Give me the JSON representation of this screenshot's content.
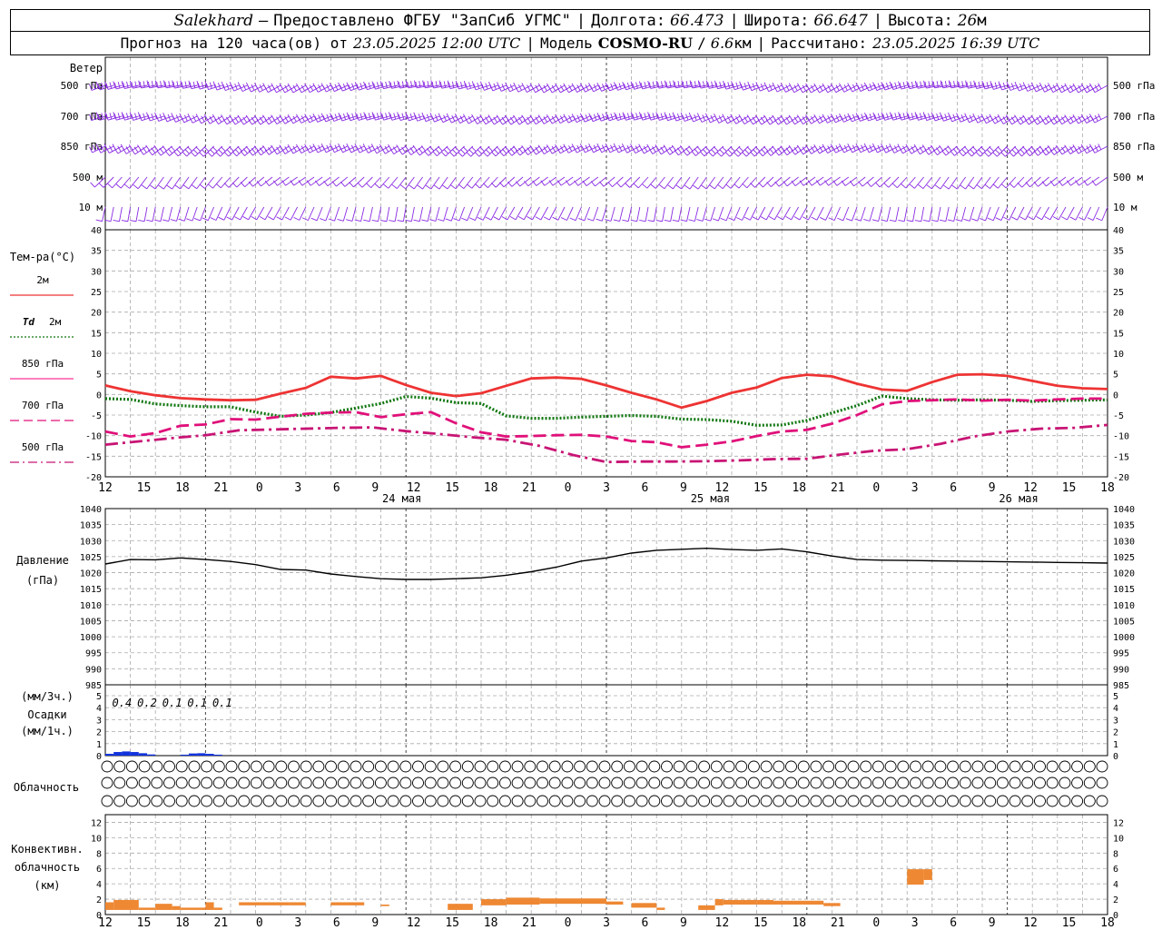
{
  "header": {
    "station": "Salekhard",
    "dash": "–",
    "provided_by": "Предоставлено ФГБУ \"ЗапСиб УГМС\"",
    "lon_label": "Долгота:",
    "lon_value": "66.473",
    "lat_label": "Широта:",
    "lat_value": "66.647",
    "alt_label": "Высота:",
    "alt_value": "26",
    "alt_unit": "м",
    "forecast_prefix": "Прогноз на 120 часа(ов) от",
    "forecast_start": "23.05.2025 12:00 UTC",
    "model_label": "Модель",
    "model_name": "COSMO-RU",
    "model_res": "6.6",
    "model_res_unit": "км",
    "calc_label": "Рассчитано:",
    "calc_time": "23.05.2025 16:39 UTC"
  },
  "colors": {
    "wind": "#8a2be2",
    "t2m": "#ee3333",
    "td2m": "#117711",
    "t850": "#ff3399",
    "t700": "#e0107a",
    "t500": "#c81474",
    "pressure": "#000000",
    "precip": "#1133dd",
    "convective": "#ee8833",
    "grid": "#aaaaaa"
  },
  "chart_data": [
    {
      "type": "wind-barbs",
      "title": "Ветер",
      "levels_left": [
        "500 гПа",
        "700 гПа",
        "850 гПа",
        "500 м",
        "10 м"
      ],
      "levels_right": [
        "500 гПа",
        "700 гПа",
        "850 гПа",
        "500 м",
        "10 м"
      ],
      "x_hours": [
        0,
        120
      ],
      "step_hours": 1
    },
    {
      "type": "line",
      "title": "Тем-ра(°C)",
      "legend": [
        {
          "label": "2м",
          "style": "solid",
          "color": "#ee3333"
        },
        {
          "label_bold": "Td",
          "label": "2м",
          "style": "dotted",
          "color": "#117711"
        },
        {
          "label": "850 гПа",
          "style": "solid",
          "color": "#ff3399"
        },
        {
          "label": "700 гПа",
          "style": "dashed",
          "color": "#e0107a"
        },
        {
          "label": "500 гПа",
          "style": "dashed",
          "color": "#c81474"
        }
      ],
      "ylim": [
        -20,
        40
      ],
      "y_ticks": [
        -20,
        -15,
        -10,
        -5,
        0,
        5,
        10,
        15,
        20,
        25,
        30,
        35,
        40
      ],
      "x_hours": [
        0,
        3,
        6,
        9,
        12,
        15,
        18,
        21,
        24,
        27,
        30,
        33,
        36,
        39,
        42,
        45,
        48,
        51,
        54,
        57,
        60,
        63,
        66,
        69,
        72,
        75,
        78,
        81,
        84,
        87,
        90,
        93,
        96,
        99,
        102,
        105,
        108,
        111,
        114,
        117,
        120
      ],
      "series": [
        {
          "name": "2м",
          "values": [
            2.2,
            0.8,
            -0.2,
            -0.9,
            -1.2,
            -1.4,
            -1.3,
            0.2,
            1.6,
            4.3,
            3.9,
            4.5,
            2.3,
            0.4,
            -0.4,
            0.3,
            2.1,
            3.9,
            4.1,
            3.8,
            2.2,
            0.4,
            -1.2,
            -3.2,
            -1.6,
            0.4,
            1.7,
            4.0,
            4.8,
            4.4,
            2.6,
            1.2,
            0.9,
            3.0,
            4.8,
            4.9,
            4.5,
            3.3,
            2.1,
            1.5,
            1.3
          ]
        },
        {
          "name": "Td 2м",
          "values": [
            -1.0,
            -1.2,
            -2.3,
            -2.7,
            -3.0,
            -3.0,
            -4.3,
            -5.3,
            -5.0,
            -4.4,
            -3.3,
            -2.2,
            -0.5,
            -0.9,
            -2.0,
            -2.2,
            -5.2,
            -5.8,
            -5.8,
            -5.5,
            -5.3,
            -5.1,
            -5.3,
            -6.0,
            -6.1,
            -6.5,
            -7.5,
            -7.4,
            -6.3,
            -4.5,
            -2.7,
            -0.4,
            -1.0,
            -1.3,
            -1.4,
            -1.3,
            -1.4,
            -1.7,
            -1.5,
            -1.4,
            -1.3
          ]
        },
        {
          "name": "850 гПа",
          "values": [
            -9.0,
            -10.2,
            -9.4,
            -7.6,
            -7.3,
            -6.0,
            -6.1,
            -5.4,
            -4.7,
            -4.4,
            -4.3,
            -5.5,
            -4.8,
            -4.3,
            -7.0,
            -9.2,
            -10.2,
            -10.1,
            -9.9,
            -9.8,
            -10.2,
            -11.3,
            -11.6,
            -12.8,
            -12.2,
            -11.4,
            -10.1,
            -9.0,
            -8.6,
            -7.1,
            -5.0,
            -2.4,
            -1.6,
            -1.4,
            -1.2,
            -1.5,
            -1.3,
            -1.5,
            -1.2,
            -1.0,
            -1.0
          ]
        },
        {
          "name": "700 гПа",
          "values": [
            -9.0,
            -10.2,
            -9.4,
            -7.6,
            -7.3,
            -6.0,
            -6.1,
            -5.4,
            -4.7,
            -4.4,
            -4.3,
            -5.5,
            -4.8,
            -4.3,
            -7.0,
            -9.2,
            -10.2,
            -10.1,
            -9.9,
            -9.8,
            -10.2,
            -11.3,
            -11.6,
            -12.8,
            -12.2,
            -11.4,
            -10.1,
            -9.0,
            -8.6,
            -7.1,
            -5.0,
            -2.4,
            -1.6,
            -1.4,
            -1.2,
            -1.5,
            -1.3,
            -1.5,
            -1.2,
            -1.0,
            -1.0
          ]
        },
        {
          "name": "500 гПа",
          "values": [
            -12.2,
            -11.4,
            -10.6,
            -9.9,
            -8.7,
            -8.5,
            -8.3,
            -8.1,
            -8.0,
            -8.9,
            -9.6,
            -10.4,
            -11.0,
            -12.5,
            -14.7,
            -16.4,
            -16.3,
            -16.3,
            -16.2,
            -16.0,
            -15.7,
            -15.6,
            -14.6,
            -13.7,
            -13.3,
            -12.0,
            -10.2,
            -9.0,
            -8.3,
            -8.1,
            -7.4
          ]
        }
      ],
      "x_tick_labels": [
        "12",
        "15",
        "18",
        "21",
        "0",
        "3",
        "6",
        "9",
        "12",
        "15",
        "18",
        "21",
        "0",
        "3",
        "6",
        "9",
        "12",
        "15",
        "18",
        "21",
        "0",
        "3",
        "6",
        "9",
        "12",
        "15",
        "18"
      ],
      "day_labels": [
        "24 мая",
        "25 мая",
        "26 мая"
      ]
    },
    {
      "type": "line",
      "title": "Давление",
      "unit": "(гПа)",
      "ylim": [
        985,
        1040
      ],
      "y_ticks": [
        985,
        990,
        995,
        1000,
        1005,
        1010,
        1015,
        1020,
        1025,
        1030,
        1035,
        1040
      ],
      "x_hours": [
        0,
        3,
        6,
        9,
        12,
        15,
        18,
        21,
        24,
        27,
        30,
        33,
        36,
        39,
        42,
        45,
        48,
        51,
        54,
        57,
        60,
        63,
        66,
        69,
        72,
        75,
        78,
        81,
        84,
        87,
        90,
        93,
        96,
        99,
        102,
        105,
        108,
        111,
        114,
        117,
        120
      ],
      "series": [
        {
          "name": "Давление",
          "values": [
            1022.7,
            1024.1,
            1024.0,
            1024.6,
            1024.1,
            1023.5,
            1022.5,
            1021.0,
            1020.8,
            1019.6,
            1018.8,
            1018.1,
            1017.9,
            1017.9,
            1018.1,
            1018.4,
            1019.2,
            1020.3,
            1021.7,
            1023.6,
            1024.6,
            1026.1,
            1027.0,
            1027.3,
            1027.6,
            1027.2,
            1027.0,
            1027.4,
            1026.5,
            1025.2,
            1024.1,
            1023.9,
            1023.8,
            1023.7,
            1023.6,
            1023.5,
            1023.4,
            1023.3,
            1023.2,
            1023.1,
            1023.0
          ]
        }
      ]
    },
    {
      "type": "bar",
      "title": "Осадки",
      "unit_top": "(мм/3ч.)",
      "unit_bottom": "(мм/1ч.)",
      "ylim": [
        0,
        5
      ],
      "y_ticks": [
        0,
        1,
        2,
        3,
        4,
        5
      ],
      "labels": [
        {
          "hour": 2,
          "text": "0.4"
        },
        {
          "hour": 5,
          "text": "0.2"
        },
        {
          "hour": 8,
          "text": "0.1"
        },
        {
          "hour": 11,
          "text": "0.1"
        },
        {
          "hour": 14,
          "text": "0.1"
        }
      ],
      "bars": [
        {
          "h0": 0,
          "h1": 1,
          "v": 0.15
        },
        {
          "h0": 1,
          "h1": 2,
          "v": 0.3
        },
        {
          "h0": 2,
          "h1": 3,
          "v": 0.35
        },
        {
          "h0": 3,
          "h1": 4,
          "v": 0.3
        },
        {
          "h0": 4,
          "h1": 5,
          "v": 0.2
        },
        {
          "h0": 5,
          "h1": 6,
          "v": 0.1
        },
        {
          "h0": 9,
          "h1": 10,
          "v": 0.08
        },
        {
          "h0": 10,
          "h1": 11,
          "v": 0.18
        },
        {
          "h0": 11,
          "h1": 12,
          "v": 0.2
        },
        {
          "h0": 12,
          "h1": 13,
          "v": 0.15
        },
        {
          "h0": 13,
          "h1": 14,
          "v": 0.08
        }
      ]
    },
    {
      "type": "table",
      "title": "Облачность",
      "rows_octas": [
        "000000000000000000000000000000000000000000000000000000000000000000000000000000000000000000000000000000000000000000000000000000000000000000000000000000000000000000000000000000000000000000000000000000000000000000000000000000000000000000000000000000000000000000000000000000000000000000000000000000000000000000000000000000000000000000000000000000000000000000000000000000000000000000000000000000000000000000",
        "00000000000000000000000000000000000000000000000000000000000000000000000000000000000000000000000000000000000000000000000000000000000000000000000000000000000000000000000000000000000000000000000000000000000000000000000000000000000000000000000000000000000000000000000000000000000000000000000000000000000000000000000000000000000000000000000000000000000000000000000000000000000000000000000000000000000000000",
        "000000000000000000000000000000000000000000000000000000000000000000000000000000000000000000000000000000000000000000000000000000000000000000000000000000000000000000000000000000000000000000000000000000000000000000000000000000000000000000000000000000000000000000000000000000000000000000000000000000000000000000000000000000000000000000000000000000000000000000000000000000000000000000000000000000000000000000000"
      ]
    },
    {
      "type": "bar",
      "title": "Конвективн.",
      "title2": "облачность",
      "unit": "(км)",
      "ylim": [
        0,
        13
      ],
      "y_ticks": [
        0,
        2,
        4,
        6,
        8,
        10,
        12
      ],
      "bars": [
        {
          "h0": 0,
          "h1": 1,
          "lo": 0.6,
          "hi": 1.6
        },
        {
          "h0": 1,
          "h1": 4,
          "lo": 0.6,
          "hi": 1.9
        },
        {
          "h0": 4,
          "h1": 6,
          "lo": 0.6,
          "hi": 0.9
        },
        {
          "h0": 6,
          "h1": 8,
          "lo": 0.6,
          "hi": 1.4
        },
        {
          "h0": 8,
          "h1": 9,
          "lo": 0.6,
          "hi": 1.1
        },
        {
          "h0": 9,
          "h1": 12,
          "lo": 0.6,
          "hi": 0.9
        },
        {
          "h0": 12,
          "h1": 13,
          "lo": 0.6,
          "hi": 1.6
        },
        {
          "h0": 13,
          "h1": 14,
          "lo": 0.6,
          "hi": 0.9
        },
        {
          "h0": 16,
          "h1": 22,
          "lo": 1.2,
          "hi": 1.6
        },
        {
          "h0": 22,
          "h1": 24,
          "lo": 1.2,
          "hi": 1.6
        },
        {
          "h0": 27,
          "h1": 31,
          "lo": 1.2,
          "hi": 1.6
        },
        {
          "h0": 33,
          "h1": 34,
          "lo": 1.1,
          "hi": 1.3
        },
        {
          "h0": 41,
          "h1": 44,
          "lo": 0.6,
          "hi": 1.4
        },
        {
          "h0": 45,
          "h1": 48,
          "lo": 1.2,
          "hi": 2.0
        },
        {
          "h0": 48,
          "h1": 52,
          "lo": 1.3,
          "hi": 2.2
        },
        {
          "h0": 52,
          "h1": 60,
          "lo": 1.4,
          "hi": 2.1
        },
        {
          "h0": 60,
          "h1": 62,
          "lo": 1.3,
          "hi": 1.7
        },
        {
          "h0": 63,
          "h1": 66,
          "lo": 0.9,
          "hi": 1.5
        },
        {
          "h0": 66,
          "h1": 67,
          "lo": 0.6,
          "hi": 0.9
        },
        {
          "h0": 71,
          "h1": 73,
          "lo": 0.6,
          "hi": 1.2
        },
        {
          "h0": 73,
          "h1": 74,
          "lo": 1.2,
          "hi": 2.0
        },
        {
          "h0": 74,
          "h1": 78,
          "lo": 1.3,
          "hi": 1.9
        },
        {
          "h0": 78,
          "h1": 80,
          "lo": 1.3,
          "hi": 1.9
        },
        {
          "h0": 80,
          "h1": 86,
          "lo": 1.3,
          "hi": 1.8
        },
        {
          "h0": 86,
          "h1": 88,
          "lo": 1.1,
          "hi": 1.5
        },
        {
          "h0": 96,
          "h1": 98,
          "lo": 3.9,
          "hi": 5.9
        },
        {
          "h0": 98,
          "h1": 99,
          "lo": 4.5,
          "hi": 5.9
        }
      ]
    }
  ]
}
